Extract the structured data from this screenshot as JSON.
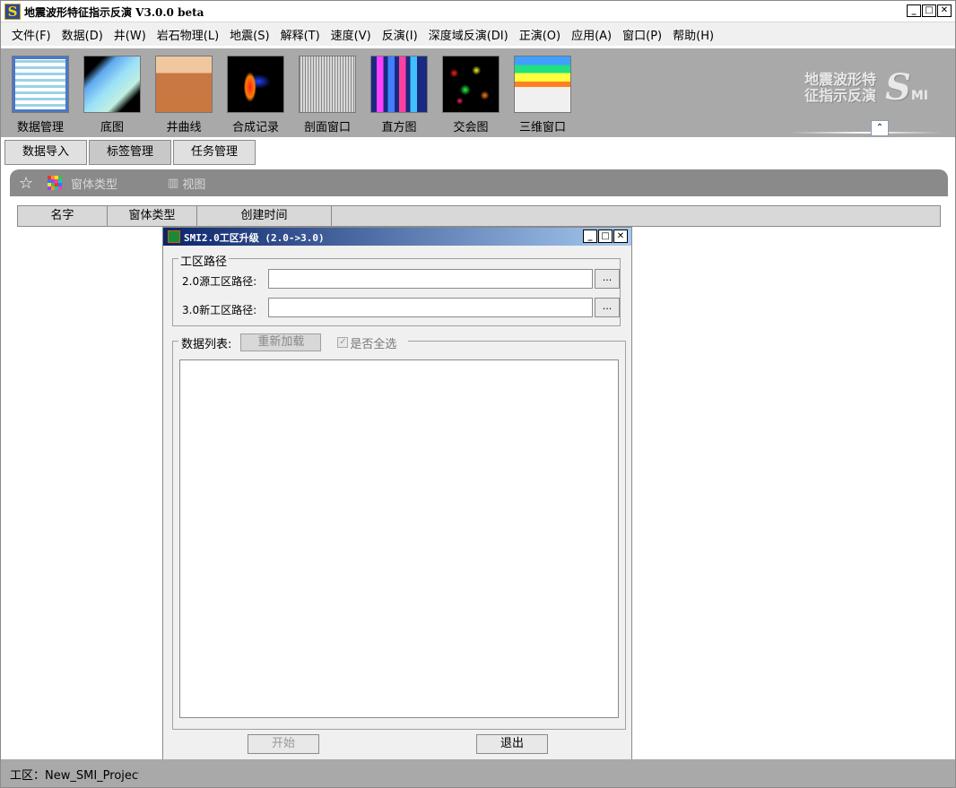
{
  "window": {
    "title": "地震波形特征指示反演 V3.0.0 beta",
    "app_icon_letter": "S",
    "controls": {
      "minimize": "_",
      "maximize": "□",
      "close": "✕"
    }
  },
  "menu": [
    "文件(F)",
    "数据(D)",
    "井(W)",
    "岩石物理(L)",
    "地震(S)",
    "解释(T)",
    "速度(V)",
    "反演(I)",
    "深度域反演(DI)",
    "正演(O)",
    "应用(A)",
    "窗口(P)",
    "帮助(H)"
  ],
  "toolbar": {
    "items": [
      {
        "label": "数据管理",
        "icon": "data-management-icon"
      },
      {
        "label": "底图",
        "icon": "basemap-icon"
      },
      {
        "label": "井曲线",
        "icon": "well-log-icon"
      },
      {
        "label": "合成记录",
        "icon": "synthetic-record-icon"
      },
      {
        "label": "剖面窗口",
        "icon": "section-window-icon"
      },
      {
        "label": "直方图",
        "icon": "histogram-icon"
      },
      {
        "label": "交会图",
        "icon": "crossplot-icon"
      },
      {
        "label": "三维窗口",
        "icon": "3d-window-icon"
      }
    ],
    "logo_line1": "地震波形特",
    "logo_line2": "征指示反演",
    "logo_mark": "S",
    "logo_sub": "MI",
    "collapse_glyph": "⌃"
  },
  "tabs": [
    "数据导入",
    "标签管理",
    "任务管理"
  ],
  "active_tab": "标签管理",
  "panel": {
    "star": "☆",
    "window_type": "窗体类型",
    "view": "视图",
    "view_icon": "▥"
  },
  "table": {
    "columns": [
      "名字",
      "窗体类型",
      "创建时间"
    ]
  },
  "dialog": {
    "title": "SMI2.0工区升级 (2.0->3.0)",
    "controls": {
      "minimize": "_",
      "maximize": "□",
      "close": "✕"
    },
    "path_group": "工区路径",
    "source_label": "2.0源工区路径:",
    "source_value": "",
    "new_label": "3.0新工区路径:",
    "new_value": "",
    "browse": "...",
    "list_label": "数据列表:",
    "reload": "重新加载",
    "select_all": "是否全选",
    "select_all_mark": "✓",
    "start": "开始",
    "exit": "退出"
  },
  "status": {
    "text": "工区：New_SMI_Project"
  }
}
